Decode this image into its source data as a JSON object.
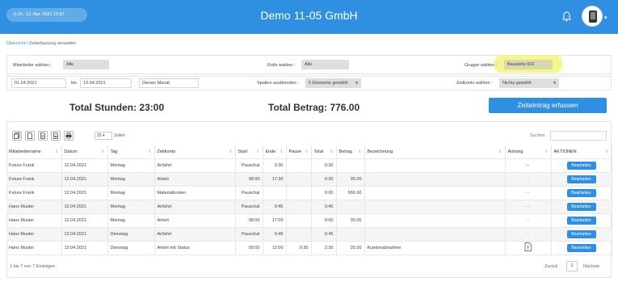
{
  "header": {
    "datetime": "◷ Di., 13. Apr. 2021 15:57",
    "company": "Demo 11-05 GmbH"
  },
  "breadcrumb": {
    "home": "Übersicht",
    "separator": " / ",
    "current": "Zeiterfassung verwalten"
  },
  "filters": {
    "employee_label": "Mitarbeiter wählen :",
    "employee_value": "Alle",
    "role_label": "Rolle wählen :",
    "role_value": "Alle",
    "group_label": "Gruppe wählen :",
    "group_value": "Baustelle 002",
    "date_from": "01.04.2021",
    "date_to_label": "bis",
    "date_to": "13.04.2021",
    "period_value": "Diesen Monat",
    "hide_columns_label": "Spalten ausblenden :",
    "hide_columns_value": "6 Elemente gewählt",
    "time_account_label": "Zeitkonto wählen :",
    "time_account_value": "Nichts gewählt"
  },
  "summary": {
    "total_hours": "Total Stunden: 23:00",
    "total_amount": "Total Betrag: 776.00",
    "add_button": "Zeiteintrag erfassen"
  },
  "toolbar": {
    "page_size": "25",
    "page_size_suffix": "Zeilen",
    "search_label": "Suchen"
  },
  "table": {
    "headers": [
      "Mitarbeitername",
      "Datum",
      "Tag",
      "Zeitkonto",
      "Start",
      "Ende",
      "Pause",
      "Total",
      "Betrag",
      "Bezeichnung",
      "Anhang",
      "AKTIONEN"
    ],
    "edit_label": "Bearbeiten",
    "rows": [
      [
        "Future Frank",
        "12.04.2021",
        "Montag",
        "Anfahrt",
        "Pauschal",
        "0:30",
        "",
        "0:30",
        "",
        "",
        "–"
      ],
      [
        "Future Frank",
        "12.04.2021",
        "Montag",
        "Arbeit",
        "08:00",
        "17:30",
        "",
        "9:30",
        "95.00",
        "",
        "-"
      ],
      [
        "Future Frank",
        "12.04.2021",
        "Montag",
        "Materialkosten",
        "Pauschal",
        "",
        "",
        "0:00",
        "566.00",
        "",
        "-"
      ],
      [
        "Hans Muster",
        "12.04.2021",
        "Montag",
        "Anfahrt",
        "Pauschal",
        "0:45",
        "",
        "0:45",
        "",
        "",
        "-"
      ],
      [
        "Hans Muster",
        "12.04.2021",
        "Montag",
        "Arbeit",
        "08:00",
        "17:00",
        "",
        "9:00",
        "90.00",
        "",
        "-"
      ],
      [
        "Hans Muster",
        "13.04.2021",
        "Dienstag",
        "Anfahrt",
        "Pauschal",
        "0:45",
        "",
        "0:45",
        "",
        "",
        "-"
      ],
      [
        "Hans Muster",
        "13.04.2021",
        "Dienstag",
        "Arbeit mit Status",
        "09:00",
        "12:00",
        "0:30",
        "2:30",
        "25.00",
        "Kundenabnahme",
        ""
      ]
    ]
  },
  "footer": {
    "info": "1 bis 7 von 7 Einträgen",
    "prev": "Zurück",
    "page": "1",
    "next": "Nächste"
  },
  "colors": {
    "accent": "#2f8fe0",
    "highlight": "#f4f47a"
  },
  "icons": [
    "clock-icon",
    "bell-icon",
    "user-avatar-icon",
    "copy-icon",
    "csv-icon",
    "excel-icon",
    "pdf-icon",
    "print-icon",
    "file-attachment-icon"
  ]
}
